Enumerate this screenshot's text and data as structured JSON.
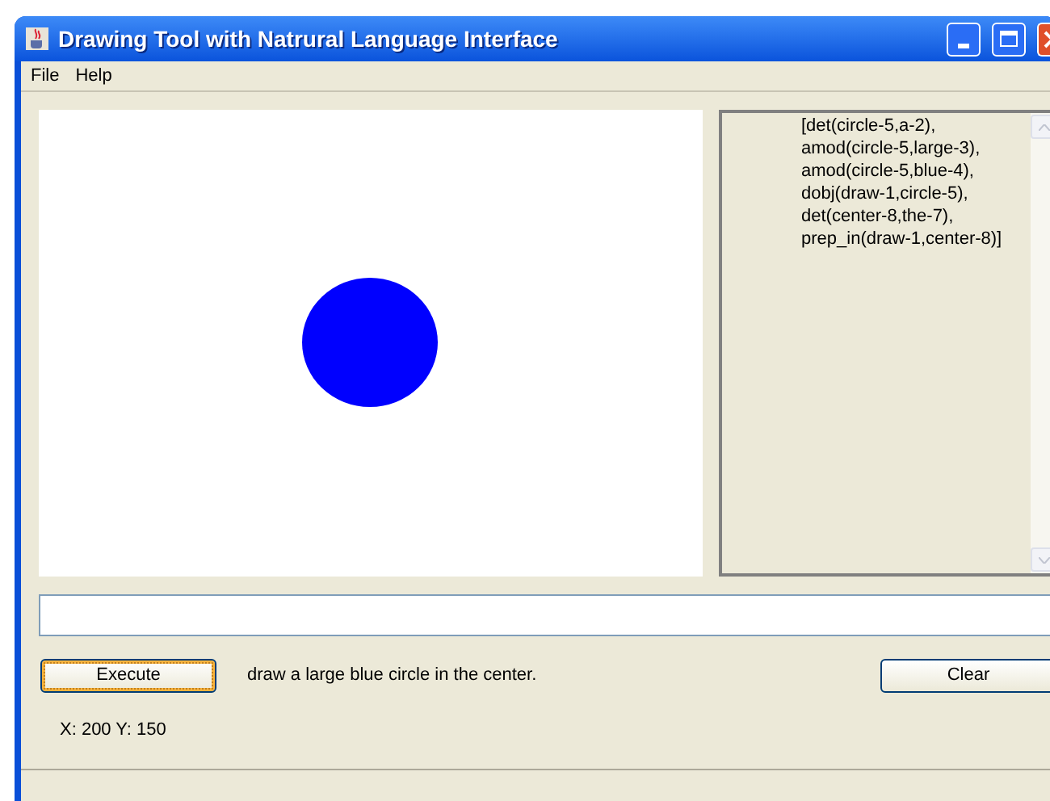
{
  "window": {
    "title": "Drawing Tool with Natrural Language Interface"
  },
  "menu": [
    "File",
    "Help"
  ],
  "parse_output": {
    "lines": [
      "[det(circle-5,a-2),",
      "amod(circle-5,large-3),",
      "amod(circle-5,blue-4),",
      "dobj(draw-1,circle-5),",
      "det(center-8,the-7),",
      "prep_in(draw-1,center-8)]"
    ]
  },
  "buttons": {
    "execute": "Execute",
    "clear": "Clear"
  },
  "command": "draw a large blue circle in the center.",
  "coordinates": "X: 200 Y: 150"
}
